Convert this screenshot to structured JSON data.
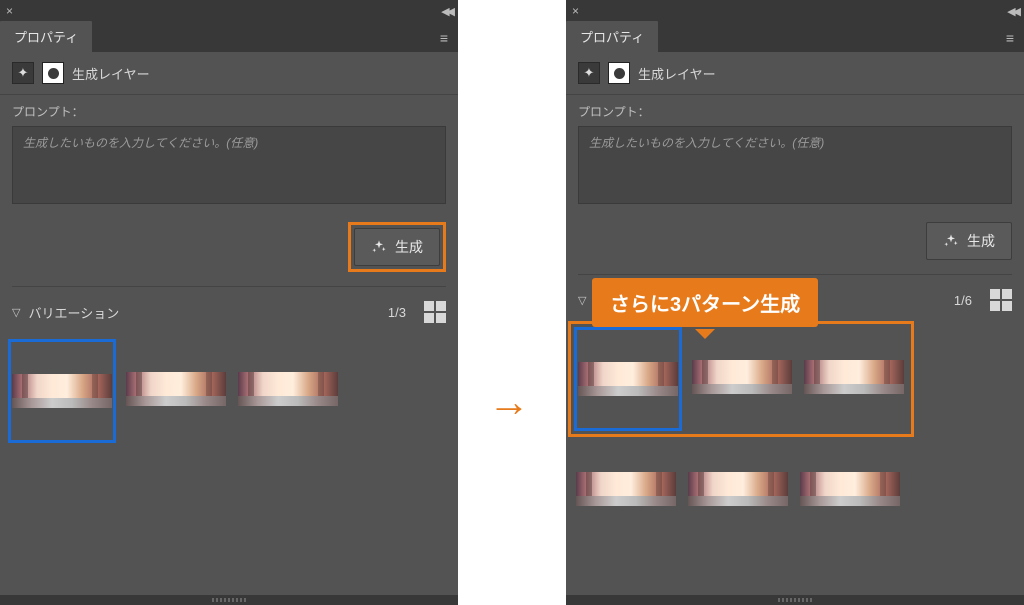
{
  "panel": {
    "tab_label": "プロパティ",
    "layer_label": "生成レイヤー",
    "prompt_label": "プロンプト：",
    "prompt_placeholder": "生成したいものを入力してください。(任意)",
    "generate_label": "生成",
    "variation_label": "バリエーション"
  },
  "left": {
    "variation_count": "1/3",
    "thumbs": [
      1,
      2,
      3
    ],
    "selected_index": 0,
    "generate_highlighted": true
  },
  "right": {
    "variation_count": "1/6",
    "thumbs": [
      1,
      2,
      3,
      4,
      5,
      6
    ],
    "selected_index": 0,
    "generate_highlighted": false
  },
  "annotations": {
    "callout_text": "さらに3パターン生成",
    "orange_box_note": "first-three-thumbs-outline",
    "arrow": "→"
  },
  "colors": {
    "panel_bg": "#535353",
    "header_bg": "#383838",
    "accent_orange": "#e77b1c",
    "select_blue": "#1a6bd6"
  }
}
